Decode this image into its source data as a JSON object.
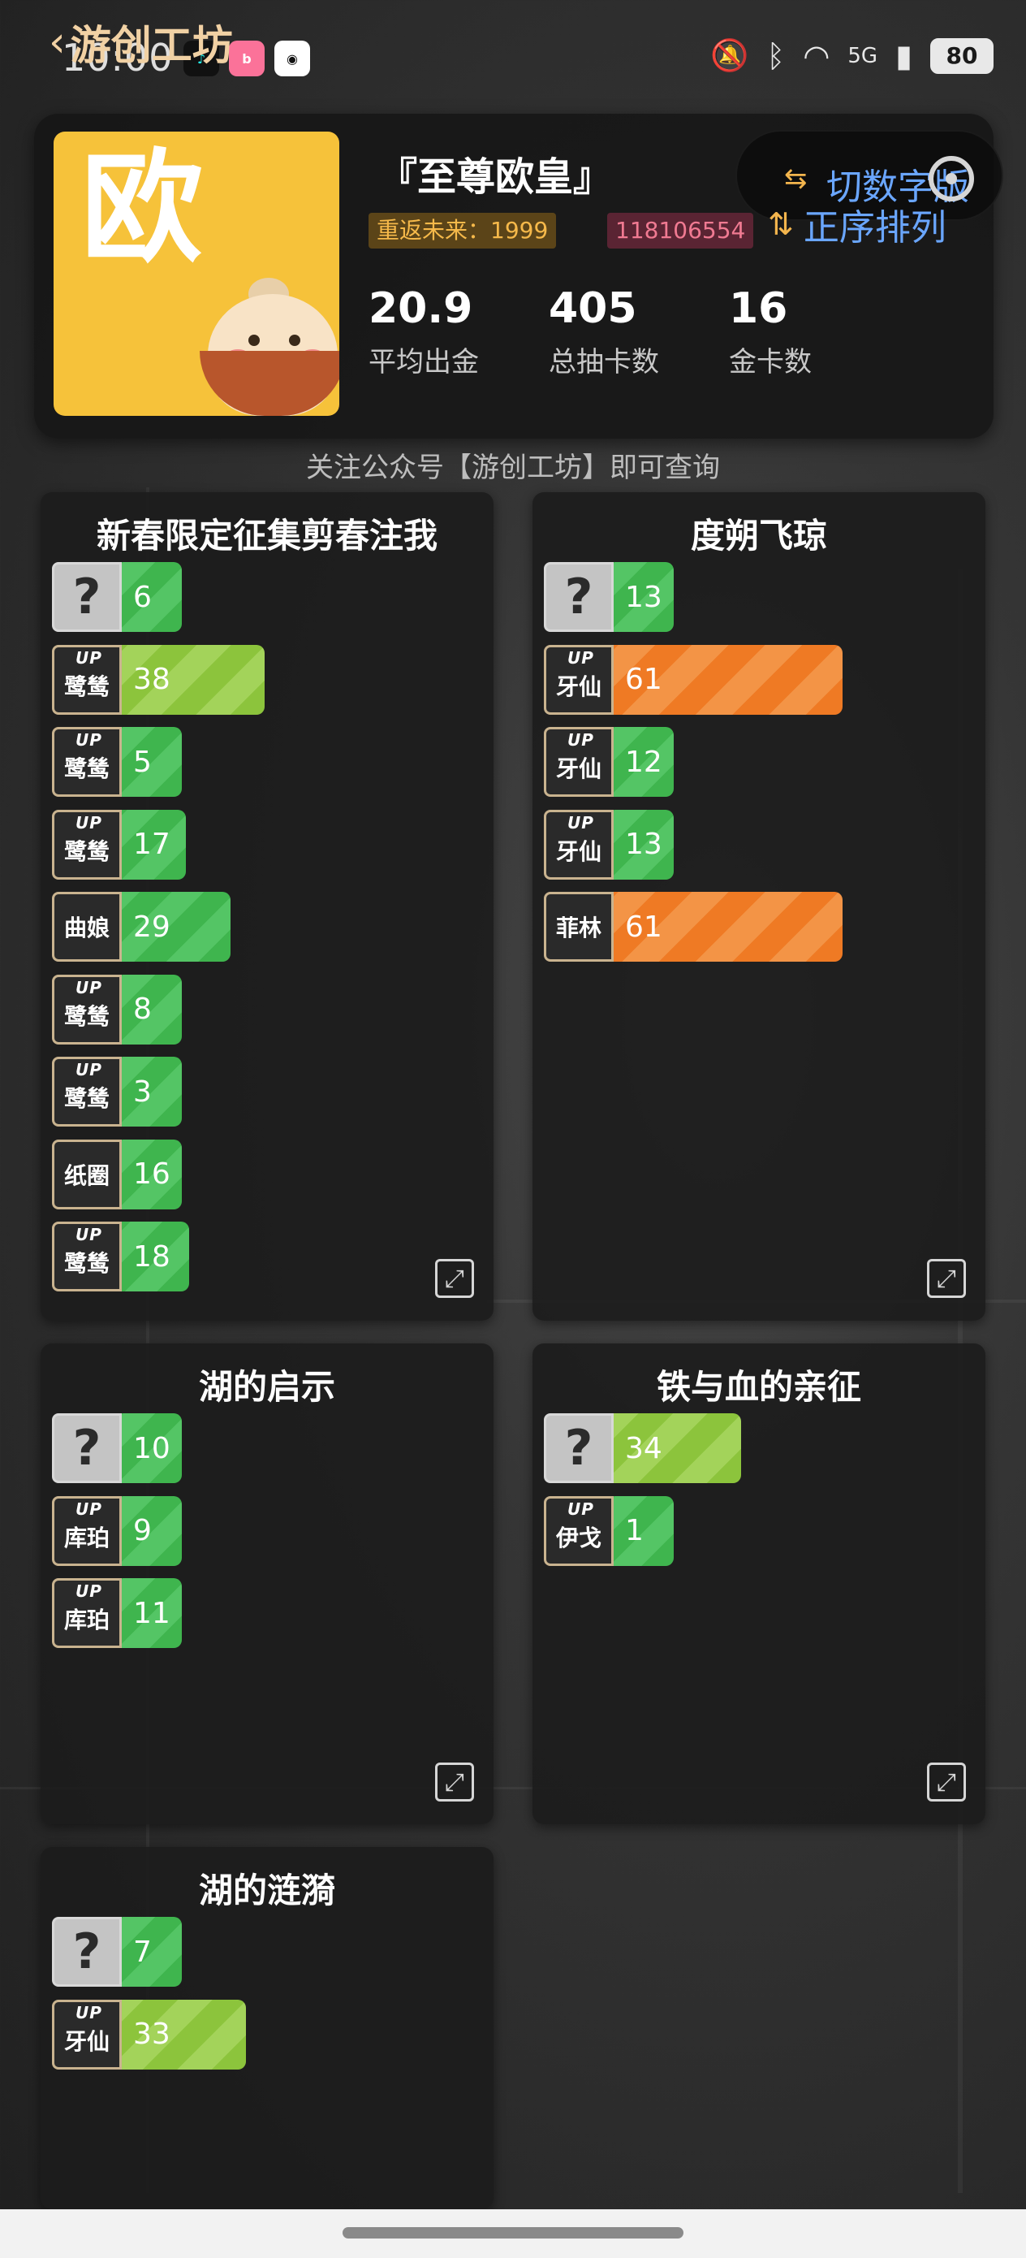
{
  "status_bar": {
    "time": "10:00",
    "apps": [
      "tiktok-icon",
      "bilibili-icon",
      "qq-icon"
    ],
    "network": "5G",
    "battery": "80"
  },
  "header": {
    "back_title": "游创工坊"
  },
  "profile": {
    "avatar_char": "欧",
    "name": "『至尊欧皇』",
    "server_badge": "重返未来：1999",
    "uid_badge": "118106554",
    "switch_label": "切数字版",
    "sort_label": "正序排列",
    "stats": [
      {
        "value": "20.9",
        "label": "平均出金"
      },
      {
        "value": "405",
        "label": "总抽卡数"
      },
      {
        "value": "16",
        "label": "金卡数"
      }
    ]
  },
  "hint": "关注公众号【游创工坊】即可查询",
  "up_tag": "UP",
  "unknown_mark": "?",
  "bar_colors": {
    "green": "#3fb54e",
    "lime": "#8cc43c",
    "orange": "#ef7a24"
  },
  "pools": [
    {
      "title": "新春限定征集剪春注我",
      "rows": [
        {
          "name": "?",
          "up": false,
          "unknown": true,
          "count": 6,
          "color": "green"
        },
        {
          "name": "鹭鸶",
          "up": true,
          "unknown": false,
          "count": 38,
          "color": "lime"
        },
        {
          "name": "鹭鸶",
          "up": true,
          "unknown": false,
          "count": 5,
          "color": "green"
        },
        {
          "name": "鹭鸶",
          "up": true,
          "unknown": false,
          "count": 17,
          "color": "green"
        },
        {
          "name": "曲娘",
          "up": false,
          "unknown": false,
          "count": 29,
          "color": "green"
        },
        {
          "name": "鹭鸶",
          "up": true,
          "unknown": false,
          "count": 8,
          "color": "green"
        },
        {
          "name": "鹭鸶",
          "up": true,
          "unknown": false,
          "count": 3,
          "color": "green"
        },
        {
          "name": "纸圈",
          "up": false,
          "unknown": false,
          "count": 16,
          "color": "green"
        },
        {
          "name": "鹭鸶",
          "up": true,
          "unknown": false,
          "count": 18,
          "color": "green"
        }
      ]
    },
    {
      "title": "度朔飞琼",
      "rows": [
        {
          "name": "?",
          "up": false,
          "unknown": true,
          "count": 13,
          "color": "green"
        },
        {
          "name": "牙仙",
          "up": true,
          "unknown": false,
          "count": 61,
          "color": "orange"
        },
        {
          "name": "牙仙",
          "up": true,
          "unknown": false,
          "count": 12,
          "color": "green"
        },
        {
          "name": "牙仙",
          "up": true,
          "unknown": false,
          "count": 13,
          "color": "green"
        },
        {
          "name": "菲林",
          "up": false,
          "unknown": false,
          "count": 61,
          "color": "orange"
        }
      ]
    },
    {
      "title": "湖的启示",
      "rows": [
        {
          "name": "?",
          "up": false,
          "unknown": true,
          "count": 10,
          "color": "green"
        },
        {
          "name": "库珀",
          "up": true,
          "unknown": false,
          "count": 9,
          "color": "green"
        },
        {
          "name": "库珀",
          "up": true,
          "unknown": false,
          "count": 11,
          "color": "green"
        }
      ]
    },
    {
      "title": "铁与血的亲征",
      "rows": [
        {
          "name": "?",
          "up": false,
          "unknown": true,
          "count": 34,
          "color": "lime"
        },
        {
          "name": "伊戈",
          "up": true,
          "unknown": false,
          "count": 1,
          "color": "green"
        }
      ]
    },
    {
      "title": "湖的涟漪",
      "rows": [
        {
          "name": "?",
          "up": false,
          "unknown": true,
          "count": 7,
          "color": "green"
        },
        {
          "name": "牙仙",
          "up": true,
          "unknown": false,
          "count": 33,
          "color": "lime"
        }
      ]
    }
  ]
}
